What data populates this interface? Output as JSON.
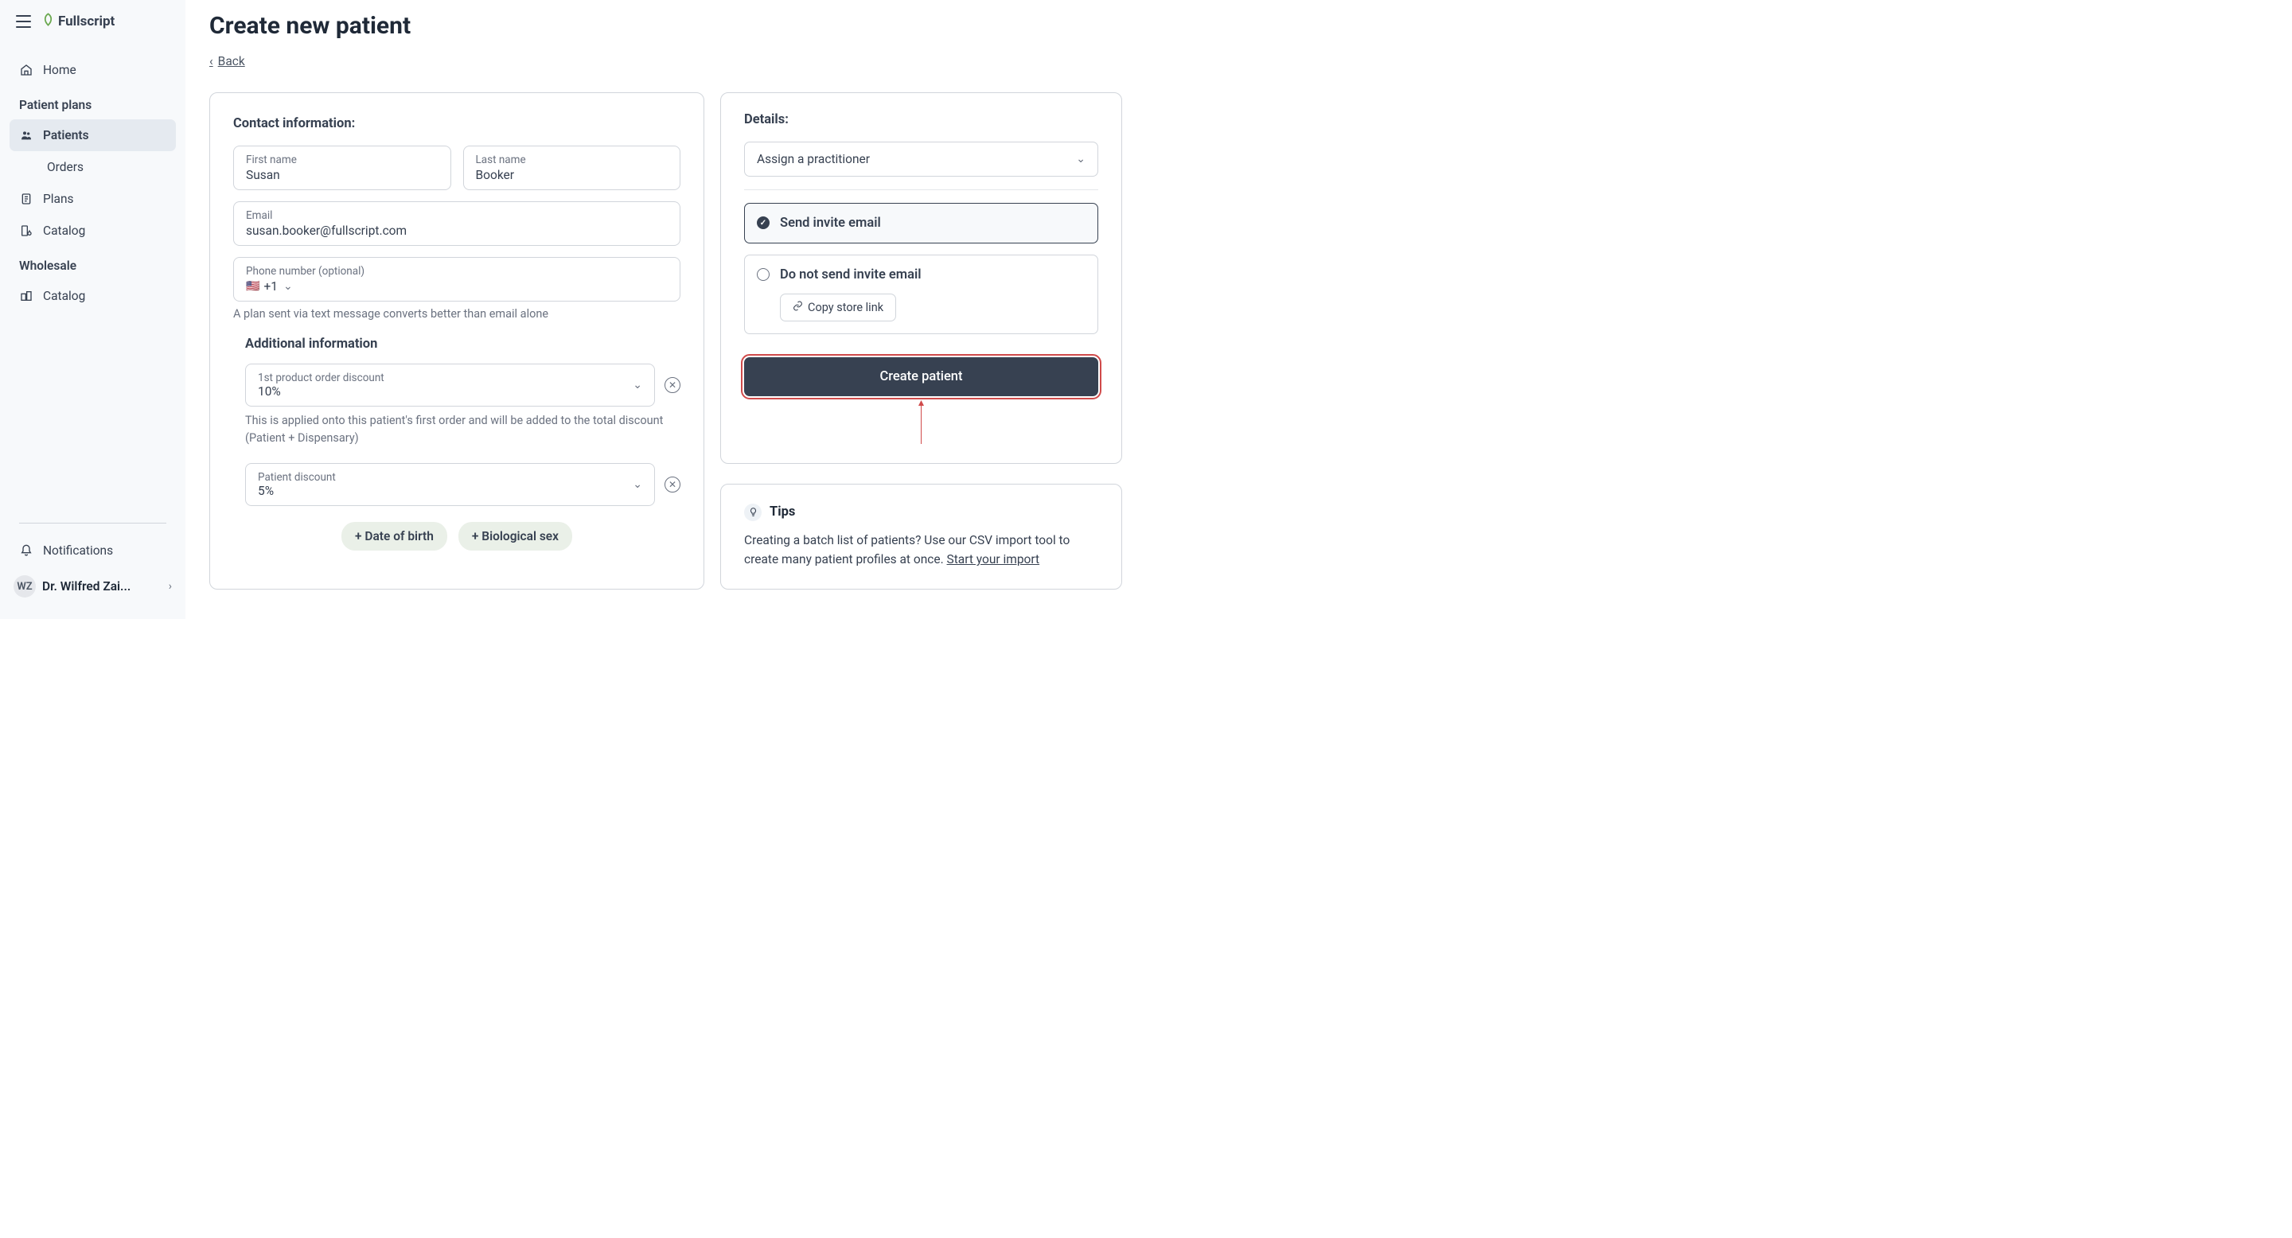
{
  "brand": {
    "name": "Fullscript"
  },
  "sidebar": {
    "home": "Home",
    "section_patient_plans": "Patient plans",
    "patients": "Patients",
    "orders": "Orders",
    "plans": "Plans",
    "catalog": "Catalog",
    "section_wholesale": "Wholesale",
    "wholesale_catalog": "Catalog",
    "notifications": "Notifications",
    "user_initials": "WZ",
    "user_name": "Dr. Wilfred Zai..."
  },
  "page": {
    "title": "Create new patient",
    "back": "Back"
  },
  "form": {
    "contact_information_label": "Contact information:",
    "first_name_label": "First name",
    "first_name_value": "Susan",
    "last_name_label": "Last name",
    "last_name_value": "Booker",
    "email_label": "Email",
    "email_value": "susan.booker@fullscript.com",
    "phone_label": "Phone number (optional)",
    "phone_code": "+1",
    "phone_helper": "A plan sent via text message converts better than email alone",
    "additional_information_label": "Additional information",
    "discount1_label": "1st product order discount",
    "discount1_value": "10%",
    "discount1_helper": "This is applied onto this patient's first order and will be added to the total discount (Patient + Dispensary)",
    "discount2_label": "Patient discount",
    "discount2_value": "5%",
    "pill_dob": "+ Date of birth",
    "pill_sex": "+ Biological sex"
  },
  "details": {
    "label": "Details:",
    "assign_practitioner": "Assign a practitioner",
    "send_invite": "Send invite email",
    "do_not_send": "Do not send invite email",
    "copy_store_link": "Copy store link",
    "create_patient": "Create patient"
  },
  "tips": {
    "title": "Tips",
    "text_part1": "Creating a batch list of patients? Use our CSV import tool to create many patient profiles at once. ",
    "link": "Start your import"
  }
}
